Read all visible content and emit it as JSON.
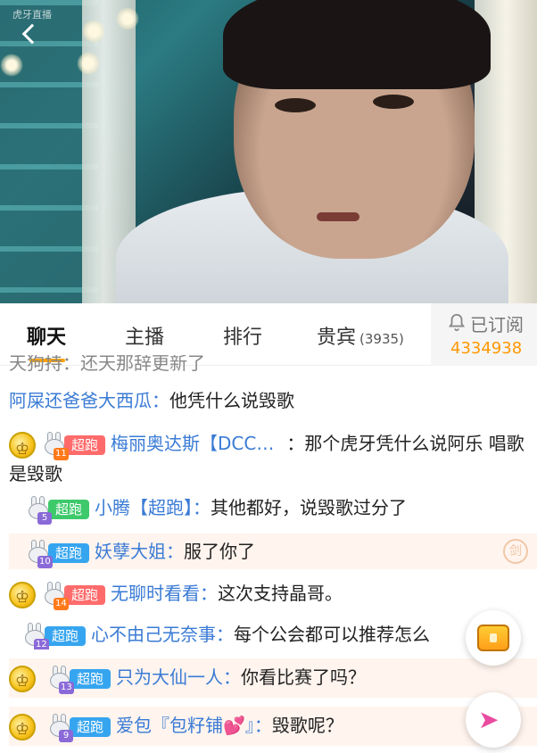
{
  "header": {
    "watermark": "虎牙直播"
  },
  "tabs": [
    {
      "label": "聊天",
      "active": true
    },
    {
      "label": "主播"
    },
    {
      "label": "排行"
    },
    {
      "label": "贵宾",
      "count": "(3935)"
    }
  ],
  "subscribe": {
    "label": "已订阅",
    "count": "4334938"
  },
  "chat": [
    {
      "nick": "天狗持：",
      "msg": "还天那辞更新了",
      "faded": true
    },
    {
      "nick": "阿屎还爸爸大西瓜：",
      "msg": "他凭什么说毁歌"
    },
    {
      "crown": true,
      "level": "11",
      "level_color": "orange",
      "tag": "超跑",
      "tag_color": "red",
      "nick": "梅丽奥达斯【DCC…",
      "sep": "：",
      "msg": "那个虎牙凭什么说阿乐 唱歌是毁歌"
    },
    {
      "level": "5",
      "level_color": "purple",
      "tag": "超跑",
      "tag_color": "green",
      "nick": "小腾【超跑】：",
      "msg": "其他都好，说毁歌过分了"
    },
    {
      "level": "10",
      "level_color": "purple",
      "tag": "超跑",
      "tag_color": "blue",
      "nick": "妖孽大姐：",
      "msg": "服了你了",
      "highlight": true
    },
    {
      "crown": true,
      "level": "14",
      "level_color": "orange",
      "tag": "超跑",
      "tag_color": "red",
      "nick": "无聊时看看：",
      "msg": "这次支持晶哥。"
    },
    {
      "level": "12",
      "level_color": "purple",
      "tag": "超跑",
      "tag_color": "blue",
      "nick": "心不由己无奈事：",
      "msg": "每个公会都可以推荐怎么"
    },
    {
      "crown": true,
      "level": "13",
      "level_color": "purple",
      "tag": "超跑",
      "tag_color": "blue",
      "nick": "只为大仙一人：",
      "msg": "你看比赛了吗？",
      "highlight": true
    },
    {
      "crown": true,
      "level": "9",
      "level_color": "purple",
      "tag": "超跑",
      "tag_color": "blue",
      "nick": "爱包『包籽铺💕』：",
      "msg": "毁歌呢？",
      "highlight": true
    }
  ],
  "side_badge": "剑"
}
